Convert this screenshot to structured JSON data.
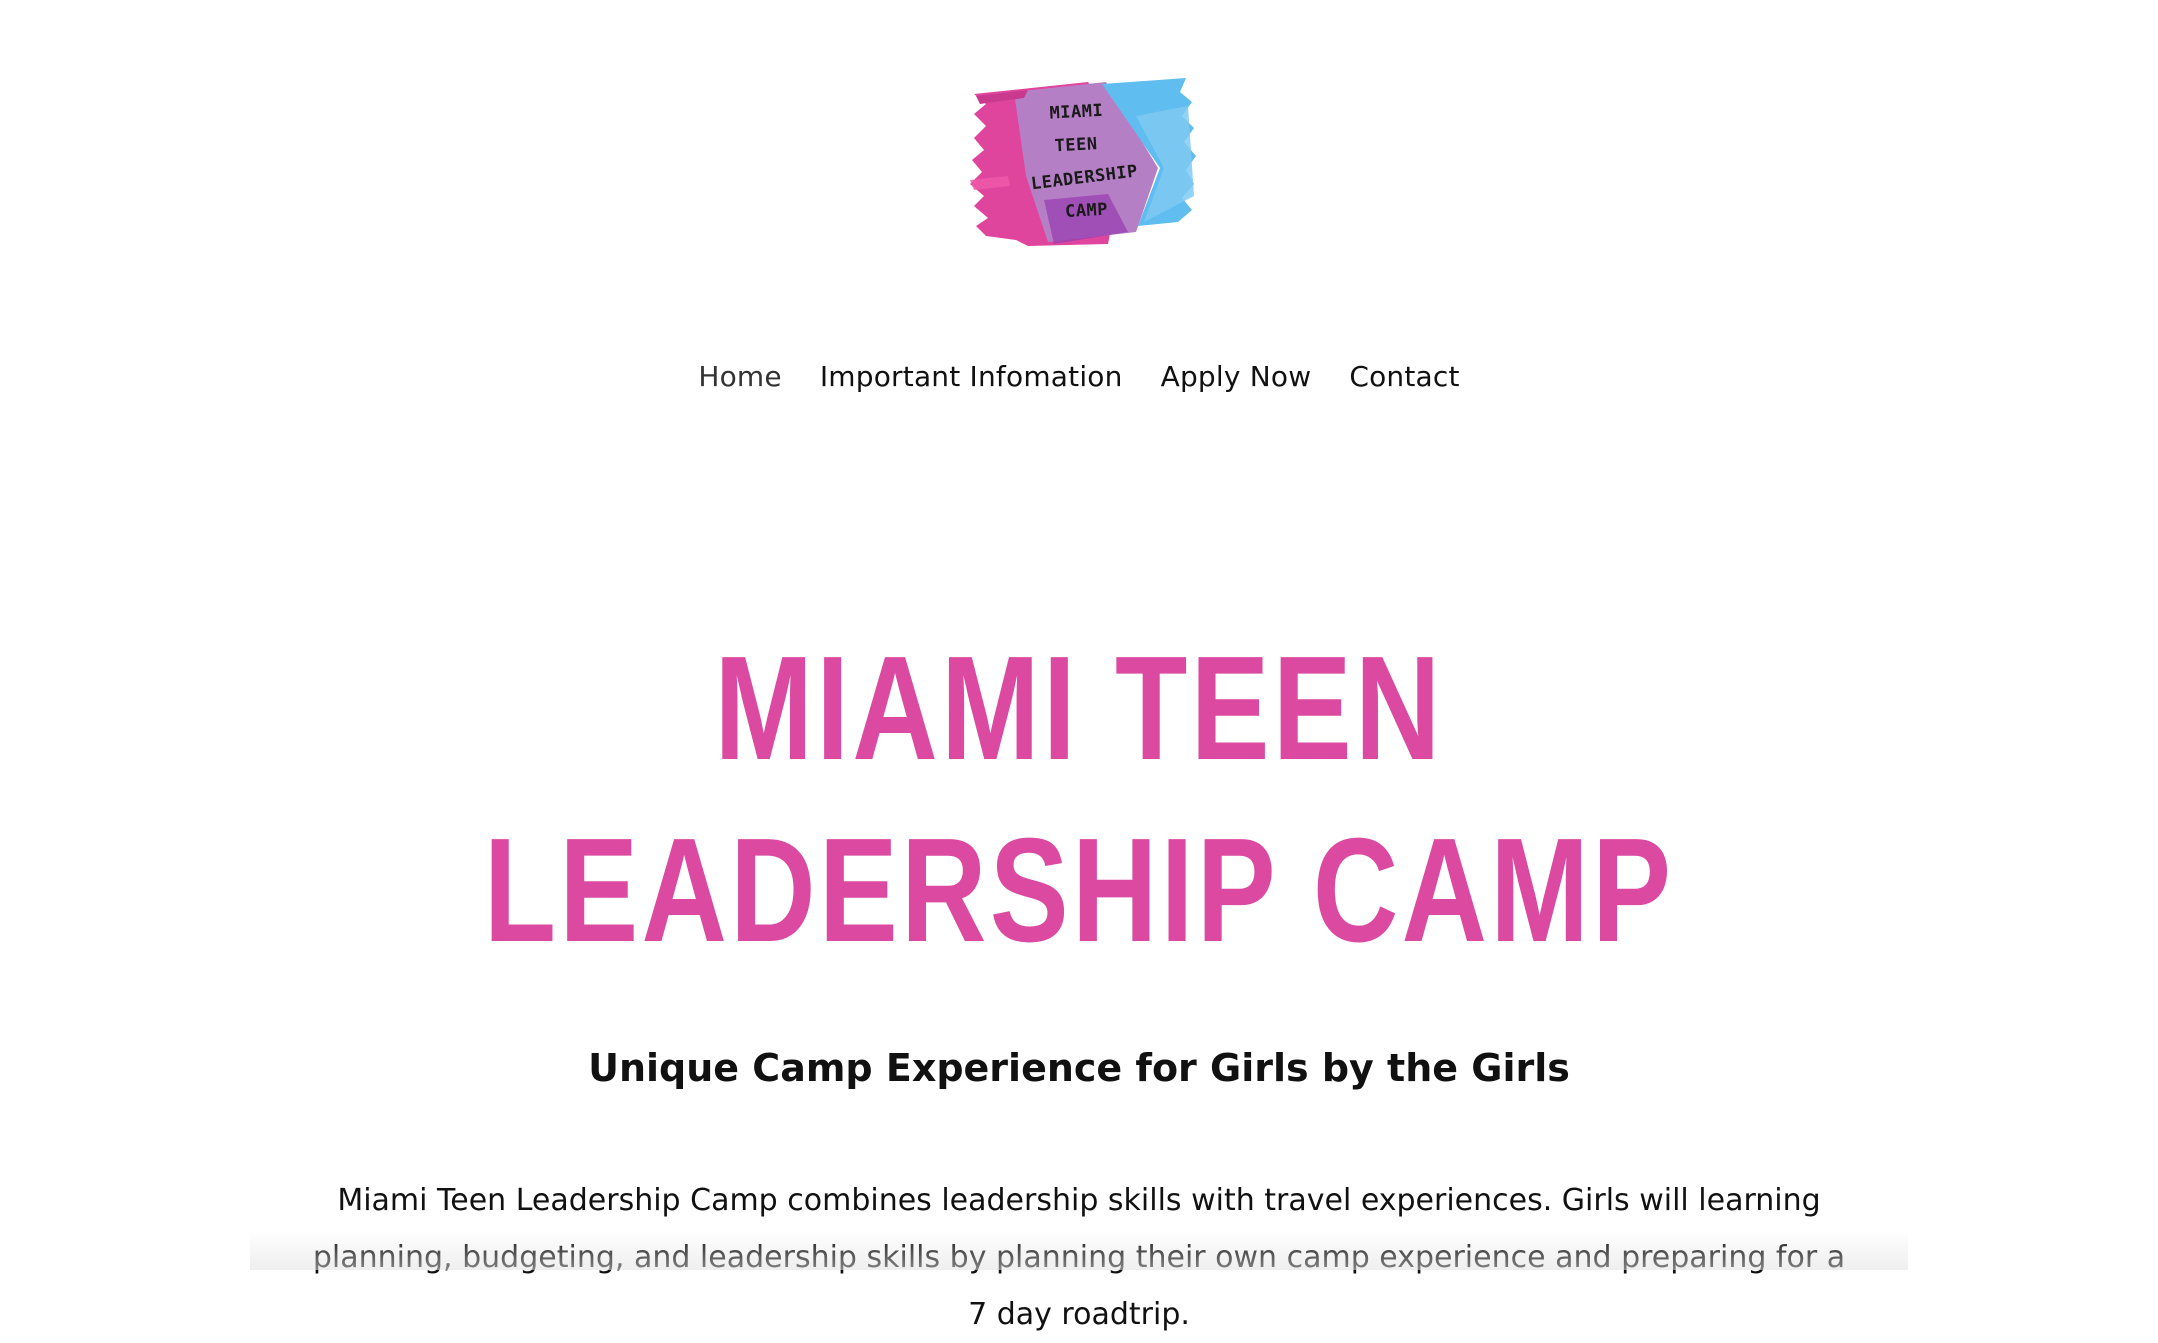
{
  "logo": {
    "lines": [
      "MIAMI",
      "TEEN",
      "LEADERSHIP",
      "CAMP"
    ],
    "colors": {
      "pink": "#e0459e",
      "purple": "#b57fc6",
      "blue": "#5fbdf0",
      "deep_purple": "#9a3fb0"
    }
  },
  "nav": {
    "items": [
      {
        "label": "Home"
      },
      {
        "label": "Important Infomation"
      },
      {
        "label": "Apply Now"
      },
      {
        "label": "Contact"
      }
    ]
  },
  "hero": {
    "title_line1": "MIAMI TEEN",
    "title_line2": "LEADERSHIP CAMP",
    "title_color": "#db49a1",
    "subtitle": "Unique Camp Experience for Girls by the Girls",
    "body": "Miami Teen Leadership Camp combines leadership skills with travel experiences. Girls will learning planning, budgeting, and leadership skills by planning their own camp experience and preparing for a 7 day roadtrip."
  }
}
